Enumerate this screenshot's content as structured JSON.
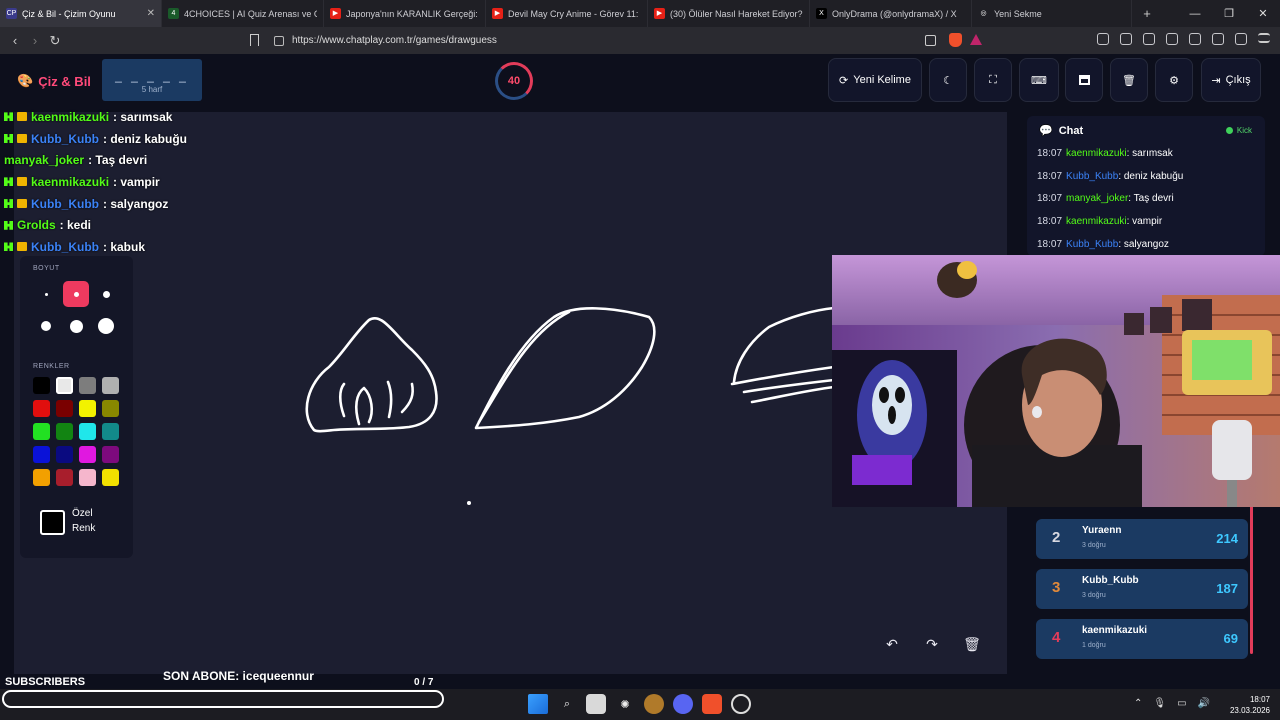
{
  "browser": {
    "tabs": [
      {
        "label": "Çiz & Bil - Çizim Oyunu",
        "favicon": "CP",
        "active": true
      },
      {
        "label": "4CHOICES | AI Quiz Arenası ve Gerçe",
        "favicon": "4"
      },
      {
        "label": "Japonya'nın KARANLIK Gerçeği: Ned",
        "favicon": "▶"
      },
      {
        "label": "Devil May Cry Anime - Görev 11: Gö",
        "favicon": "▶"
      },
      {
        "label": "(30) Ölüler Nasıl Hareket Ediyor? - Yo",
        "favicon": "▶"
      },
      {
        "label": "OnlyDrama (@onlydramaX) / X",
        "favicon": "X"
      },
      {
        "label": "Yeni Sekme",
        "favicon": "◎"
      }
    ],
    "url": "https://www.chatplay.com.tr/games/drawguess"
  },
  "header": {
    "logo_text": "Çiz & Bil",
    "word_mask": "_ _ _ _ _",
    "word_hint": "5 harf",
    "timer": "40",
    "new_word_label": "Yeni Kelime",
    "exit_label": "Çıkış"
  },
  "overlay_chat": [
    {
      "user": "kaenmikazuki",
      "msg": ": sarımsak",
      "color": "#53fc18",
      "badges": [
        "kick",
        "crown"
      ]
    },
    {
      "user": "Kubb_Kubb",
      "msg": ": deniz kabuğu",
      "color": "#3b82f6",
      "badges": [
        "kick",
        "crown"
      ]
    },
    {
      "user": "manyak_joker",
      "msg": ": Taş devri",
      "color": "#53fc18",
      "badges": []
    },
    {
      "user": "kaenmikazuki",
      "msg": ": vampir",
      "color": "#53fc18",
      "badges": [
        "kick",
        "crown"
      ]
    },
    {
      "user": "Kubb_Kubb",
      "msg": ": salyangoz",
      "color": "#3b82f6",
      "badges": [
        "kick",
        "crown"
      ]
    },
    {
      "user": "Grolds",
      "msg": ": kedi",
      "color": "#53fc18",
      "badges": [
        "kick"
      ]
    },
    {
      "user": "Kubb_Kubb",
      "msg": ": kabuk",
      "color": "#3b82f6",
      "badges": [
        "kick",
        "crown"
      ]
    }
  ],
  "toolbar": {
    "size_label": "BOYUT",
    "colors_label": "RENKLER",
    "custom_label_1": "Özel",
    "custom_label_2": "Renk",
    "colors": [
      "#000000",
      "#e8e8e8",
      "#7d7d7d",
      "#b0b0b0",
      "#e10e0e",
      "#7a0000",
      "#f2f200",
      "#888800",
      "#22e022",
      "#128412",
      "#20e6ea",
      "#128a8a",
      "#0a12d8",
      "#0a0a80",
      "#e018e0",
      "#7d0a7d",
      "#f2a000",
      "#a81e2c",
      "#f5b6cc",
      "#f2e000"
    ]
  },
  "chat": {
    "title": "Chat",
    "live_label": "Kick",
    "messages": [
      {
        "time": "18:07",
        "user": "kaenmikazuki",
        "msg": ": sarımsak",
        "color": "#53fc18"
      },
      {
        "time": "18:07",
        "user": "Kubb_Kubb",
        "msg": ": deniz kabuğu",
        "color": "#3b82f6"
      },
      {
        "time": "18:07",
        "user": "manyak_joker",
        "msg": ": Taş devri",
        "color": "#53fc18"
      },
      {
        "time": "18:07",
        "user": "kaenmikazuki",
        "msg": ": vampir",
        "color": "#53fc18"
      },
      {
        "time": "18:07",
        "user": "Kubb_Kubb",
        "msg": ": salyangoz",
        "color": "#3b82f6"
      }
    ]
  },
  "leaderboard": [
    {
      "rank": "2",
      "name": "Yuraenn",
      "sub": "3 doğru",
      "score": "214",
      "rank_color": "#d8d8e0"
    },
    {
      "rank": "3",
      "name": "Kubb_Kubb",
      "sub": "3 doğru",
      "score": "187",
      "rank_color": "#e0893a"
    },
    {
      "rank": "4",
      "name": "kaenmikazuki",
      "sub": "1 doğru",
      "score": "69",
      "rank_color": "#e23c5a"
    }
  ],
  "stream": {
    "subscribers_label": "SUBSCRIBERS",
    "son_abone": "SON ABONE: icequeennur",
    "progress": "0  / 7"
  },
  "taskbar": {
    "time": "18:07",
    "date": "23.03.2026"
  }
}
